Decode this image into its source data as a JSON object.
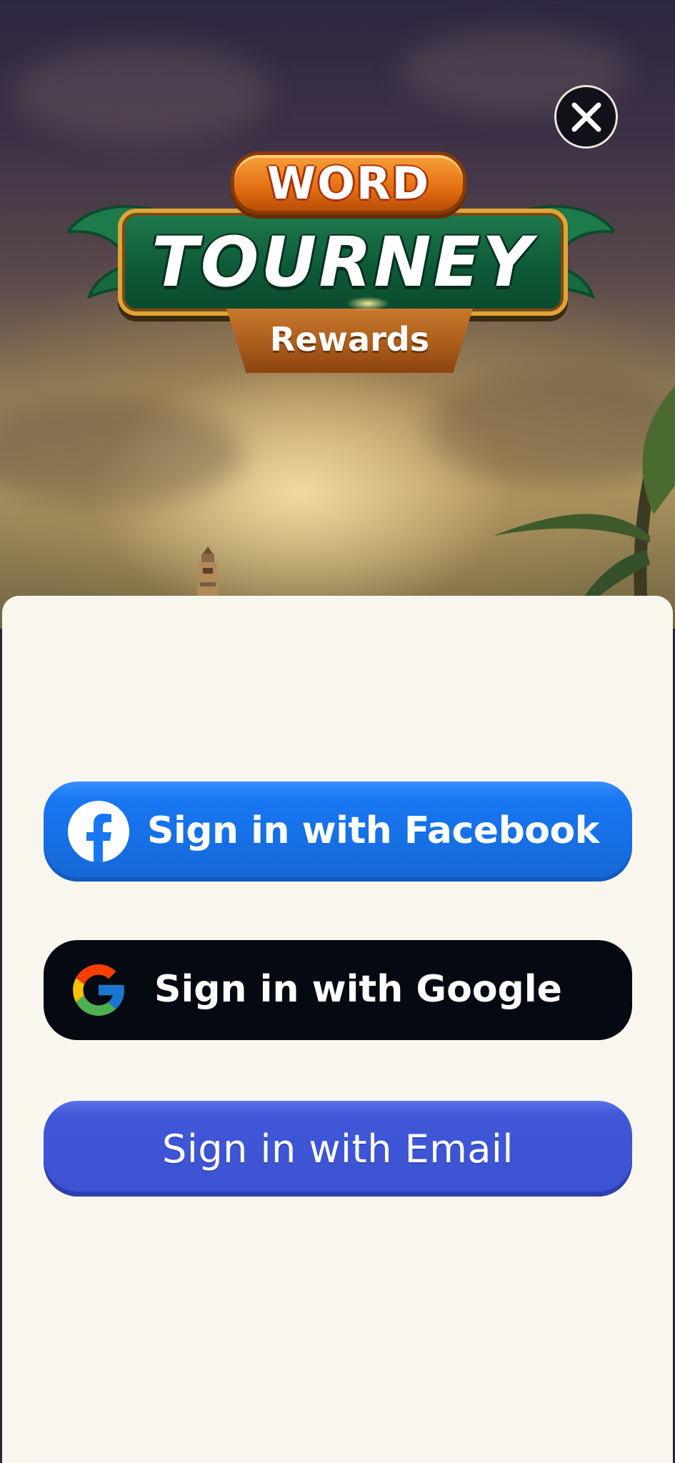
{
  "logo": {
    "word": "WORD",
    "tourney": "TOURNEY",
    "rewards": "Rewards"
  },
  "close_button": {
    "icon": "close-icon"
  },
  "auth": {
    "facebook_label": "Sign in with Facebook",
    "facebook_icon": "facebook-icon",
    "google_label": "Sign in with Google",
    "google_icon": "google-icon",
    "email_label": "Sign in with Email"
  },
  "colors": {
    "facebook": "#1877f2",
    "google": "#050a12",
    "email": "#3b52d2",
    "sheet": "#f9f6ee"
  }
}
